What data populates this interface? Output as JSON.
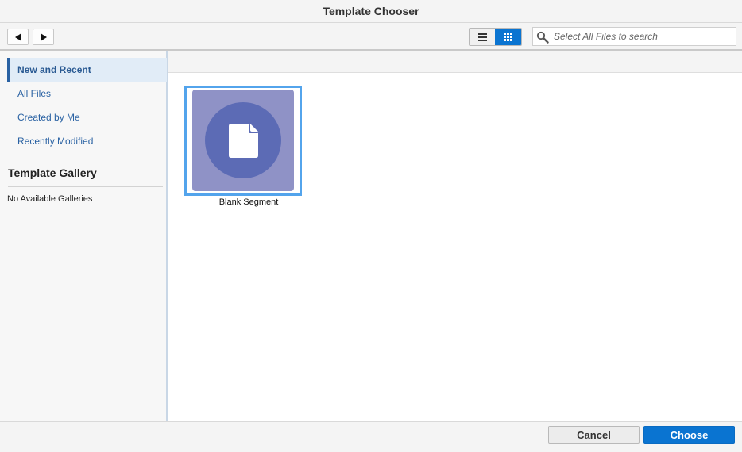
{
  "window": {
    "title": "Template Chooser"
  },
  "toolbar": {
    "back_icon": "back-arrow-icon",
    "forward_icon": "forward-arrow-icon",
    "list_view_icon": "list-view-icon",
    "grid_view_icon": "grid-view-icon",
    "active_view": "grid",
    "search": {
      "placeholder": "Select All Files to search",
      "value": ""
    }
  },
  "sidebar": {
    "items": [
      {
        "label": "New and Recent",
        "selected": true
      },
      {
        "label": "All Files",
        "selected": false
      },
      {
        "label": "Created by Me",
        "selected": false
      },
      {
        "label": "Recently Modified",
        "selected": false
      }
    ],
    "gallery_heading": "Template Gallery",
    "gallery_empty": "No Available Galleries"
  },
  "main": {
    "templates": [
      {
        "label": "Blank Segment",
        "icon": "document-icon",
        "selected": true
      }
    ]
  },
  "footer": {
    "cancel_label": "Cancel",
    "choose_label": "Choose"
  },
  "colors": {
    "accent": "#0a74d1",
    "tile_bg": "#8f92c6",
    "tile_circle": "#5c6bb5",
    "selection_border": "#53a4ec"
  }
}
